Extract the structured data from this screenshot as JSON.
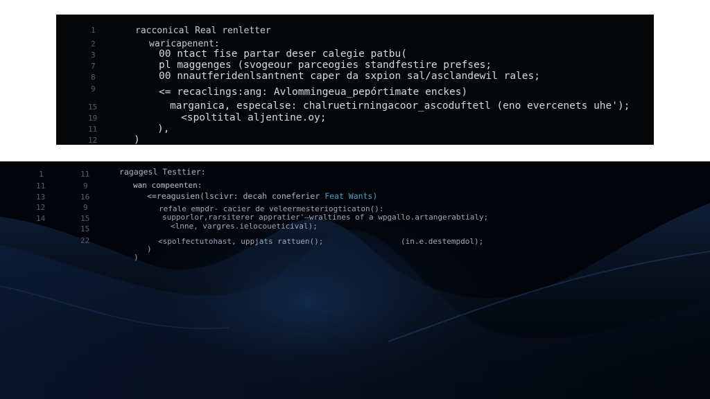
{
  "top_editor": {
    "line_numbers": [
      "1",
      "2",
      "3",
      "7",
      "8",
      "9",
      "15",
      "19",
      "11",
      "12"
    ],
    "lines": [
      "racconical Real renletter",
      "waricapenent:",
      "00 ntact fise partar deser calegie patbu(",
      "pl maggenges (svogeour parceogies standfestire prefses;",
      "00 nnautferidenlsantnent caper da sxpion sal/asclandewil rales;",
      "<= recaclings:ang: Avlommingeua_pepórtimate enckes)",
      "marganica, especalse: chalruetirningacoor_ascoduftetl (eno evercenets uhe');",
      "<spoltital aljentine.oy;",
      "),",
      ")"
    ]
  },
  "bottom_editor": {
    "line_numbers_left": [
      "1",
      "11",
      "13",
      "12",
      "14"
    ],
    "line_numbers_right": [
      "11",
      "9",
      "16",
      "9",
      "15",
      "15",
      "22"
    ],
    "lines": [
      "ragagesl Testtier:",
      "wan compeenten:",
      "<=reagusien(lscivr: decah coneferier ",
      "Feat Wants)",
      "refale empdr- cacier de veleermesteriogticaton():",
      "supporlor,rarsiterer appratier'—wraltines of a wpgallo.artangerabtialy;",
      "<lnne, vargres.ielocoueticival);",
      "<spolfectutohast, uppjats rattuen();",
      "(in.e.destempdol);",
      ")",
      ")"
    ]
  },
  "colors": {
    "top_panel_bg": "#050608",
    "bottom_bg": "#02040a",
    "wave_blue": "#1c3f6e",
    "accent": "#4aa0c0"
  }
}
